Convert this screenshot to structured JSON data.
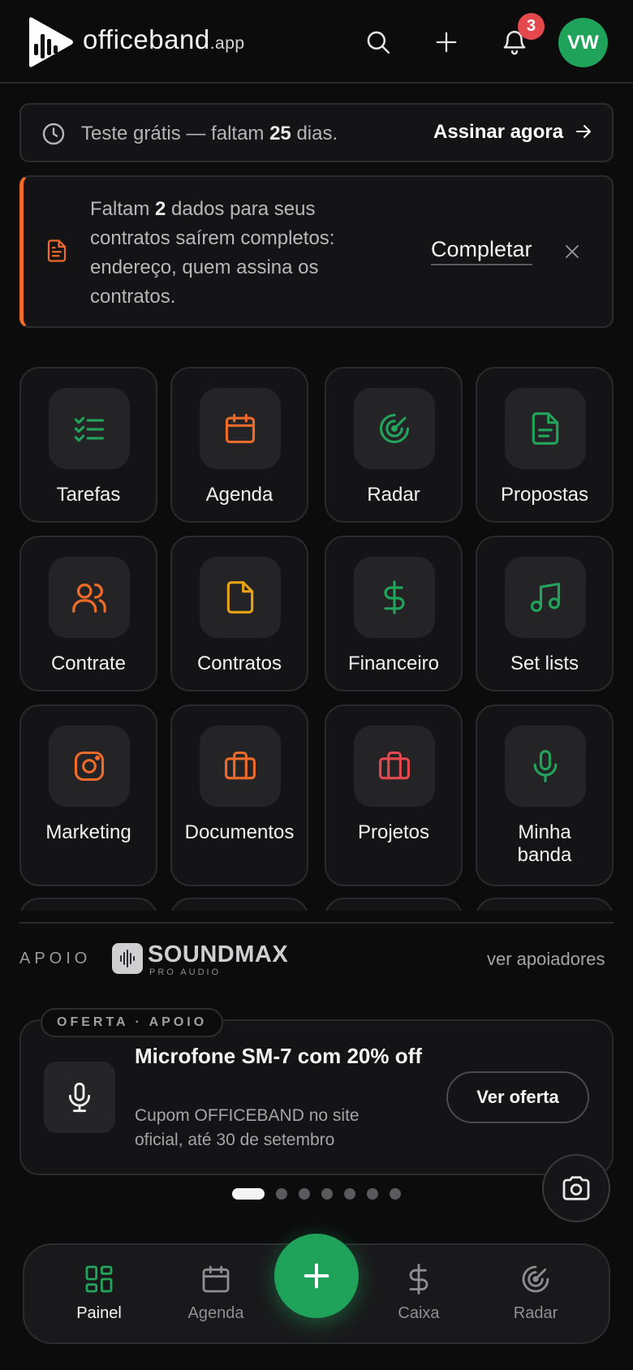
{
  "header": {
    "brand_main": "officeband",
    "brand_suffix": ".app",
    "notifications_count": "3",
    "avatar_initials": "VW"
  },
  "trial": {
    "text_prefix": "Teste grátis — faltam ",
    "days": "25",
    "text_suffix": " dias.",
    "cta": "Assinar agora"
  },
  "alert": {
    "prefix": "Faltam ",
    "count": "2",
    "suffix": " dados para seus contratos saírem completos: endereço, quem assina os contratos.",
    "cta": "Completar"
  },
  "grid": [
    {
      "label": "Tarefas",
      "icon": "checklist-icon",
      "color": "#22a55b"
    },
    {
      "label": "Agenda",
      "icon": "calendar-icon",
      "color": "#ee6b2a"
    },
    {
      "label": "Radar",
      "icon": "radar-icon",
      "color": "#22a55b"
    },
    {
      "label": "Propostas",
      "icon": "document-icon",
      "color": "#22a55b"
    },
    {
      "label": "Contrate",
      "icon": "users-icon",
      "color": "#ee6b2a"
    },
    {
      "label": "Contratos",
      "icon": "file-icon",
      "color": "#e8a317"
    },
    {
      "label": "Financeiro",
      "icon": "dollar-icon",
      "color": "#22a55b"
    },
    {
      "label": "Set lists",
      "icon": "music-icon",
      "color": "#22a55b"
    },
    {
      "label": "Marketing",
      "icon": "instagram-icon",
      "color": "#ee6b2a"
    },
    {
      "label": "Documentos",
      "icon": "briefcase-icon",
      "color": "#ee6b2a"
    },
    {
      "label": "Projetos",
      "icon": "briefcase-icon",
      "color": "#e5484d"
    },
    {
      "label": "Minha banda",
      "icon": "microphone-icon",
      "color": "#22a55b"
    }
  ],
  "support": {
    "label": "APOIO",
    "sponsor_name": "SOUNDMAX",
    "sponsor_sub": "PRO AUDIO",
    "link": "ver apoiadores"
  },
  "offer": {
    "tag": "OFERTA · APOIO",
    "title": "Microfone SM-7 com 20% off",
    "description": "Cupom OFFICEBAND no site oficial, até 30 de setembro",
    "button": "Ver oferta"
  },
  "carousel": {
    "total": 7,
    "active": 0
  },
  "nav": {
    "items": [
      {
        "label": "Painel",
        "icon": "dashboard-icon"
      },
      {
        "label": "Agenda",
        "icon": "calendar-icon"
      },
      {
        "label": "Caixa",
        "icon": "dollar-icon"
      },
      {
        "label": "Radar",
        "icon": "radar-icon"
      }
    ]
  },
  "colors": {
    "accent_green": "#1fa35a",
    "accent_orange": "#ee6b2a",
    "badge_red": "#e5484d",
    "background": "#0c0c0d"
  }
}
